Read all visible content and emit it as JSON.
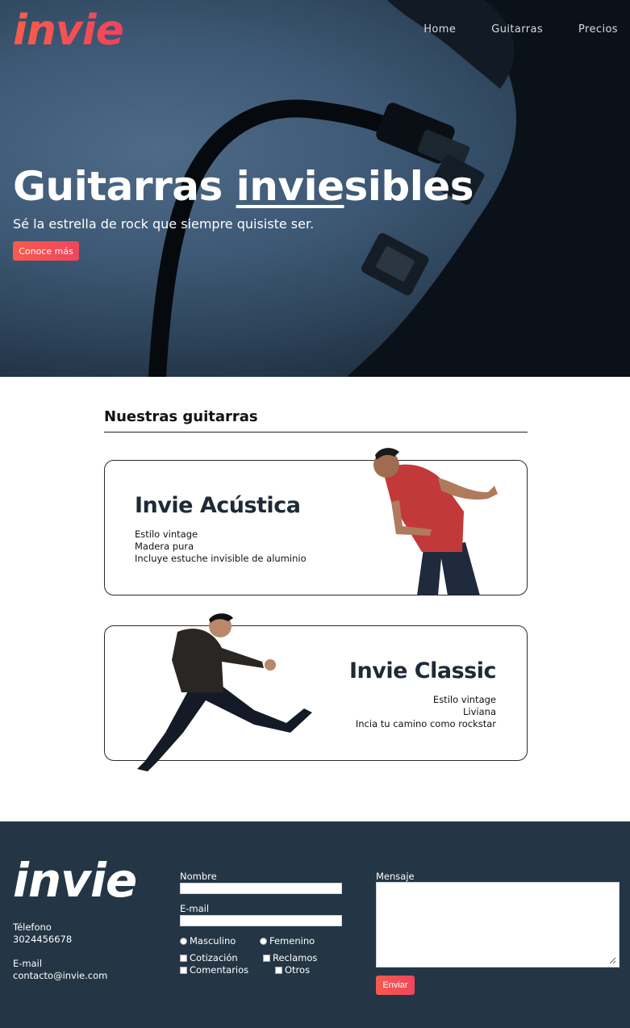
{
  "brand": {
    "logo_text": "invie",
    "accent_color": "#f2544d",
    "footer_bg": "#243646"
  },
  "nav": {
    "items": [
      "Home",
      "Guitarras",
      "Precios"
    ]
  },
  "hero": {
    "title_start": "Guitarras ",
    "title_underlined": "invie",
    "title_end": "sibles",
    "subtitle": "Sé la estrella de rock que siempre quisiste ser.",
    "button_label": "Conoce más"
  },
  "products": {
    "section_title": "Nuestras guitarras",
    "cards": [
      {
        "title": "Invie Acústica",
        "features": [
          "Estilo vintage",
          "Madera pura",
          "Incluye estuche invisible de aluminio"
        ]
      },
      {
        "title": "Invie Classic",
        "features": [
          "Estilo vintage",
          "Liviana",
          "Incia tu camino como rockstar"
        ]
      }
    ]
  },
  "footer": {
    "logo_text": "invie",
    "phone_label": "Télefono",
    "phone_value": "3024456678",
    "email_label": "E-mail",
    "email_value": "contacto@invie.com",
    "form": {
      "name_label": "Nombre",
      "email_label": "E-mail",
      "gender_options": [
        "Masculino",
        "Femenino"
      ],
      "topics": [
        "Cotización",
        "Reclamos",
        "Comentarios",
        "Otros"
      ],
      "message_label": "Mensaje",
      "submit_label": "Enviar"
    }
  }
}
